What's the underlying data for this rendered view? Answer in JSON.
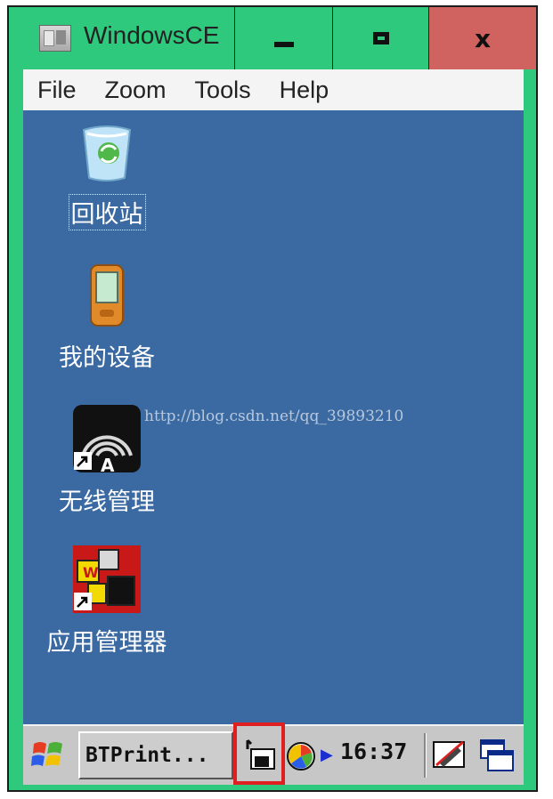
{
  "window": {
    "title": "WindowsCE",
    "close_glyph": "x"
  },
  "menubar": {
    "items": [
      "File",
      "Zoom",
      "Tools",
      "Help"
    ]
  },
  "desktop": {
    "icons": [
      {
        "label": "回收站",
        "icon": "recycle-bin-icon",
        "selected": true
      },
      {
        "label": "我的设备",
        "icon": "my-device-icon",
        "selected": false
      },
      {
        "label": "无线管理",
        "icon": "wireless-manager-icon",
        "selected": false
      },
      {
        "label": "应用管理器",
        "icon": "app-manager-icon",
        "selected": false
      }
    ],
    "watermark": "http://blog.csdn.net/qq_39893210"
  },
  "taskbar": {
    "start_icon": "windows-start-icon",
    "task_button_label": "BTPrint...",
    "clock": "16:37",
    "tray_icons": [
      "network-tray-icon",
      "color-wheel-icon",
      "pen-input-icon",
      "task-switch-icon"
    ],
    "highlight_color": "#e02020"
  },
  "colors": {
    "frame": "#2ec97d",
    "desktop": "#3b6aa3",
    "close": "#d0635f",
    "taskbar": "#c7c7c7"
  }
}
